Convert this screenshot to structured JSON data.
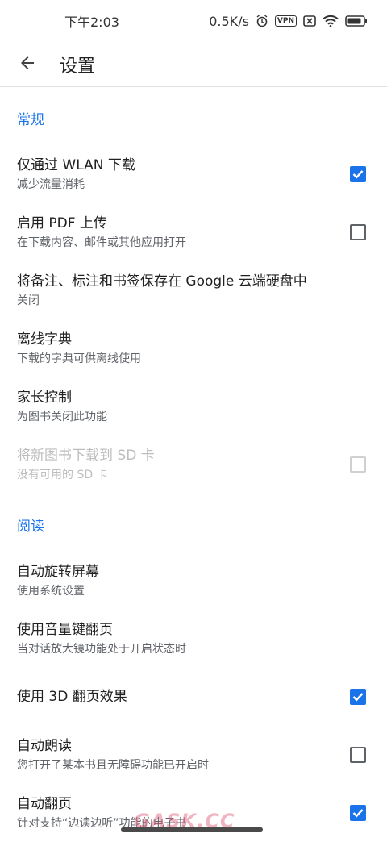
{
  "status_bar": {
    "time": "下午2:03",
    "network_speed": "0.5K/s",
    "vpn_label": "VPN",
    "icons": [
      "alarm-icon",
      "vpn-icon",
      "sim-off-icon",
      "wifi-icon",
      "battery-icon"
    ]
  },
  "app_bar": {
    "back_icon": "arrow-left-icon",
    "title": "设置"
  },
  "sections": {
    "general": {
      "header": "常规",
      "wlan": {
        "title": "仅通过 WLAN 下载",
        "summary": "减少流量消耗",
        "checked": true
      },
      "pdf": {
        "title": "启用 PDF 上传",
        "summary": "在下载内容、邮件或其他应用打开",
        "checked": false
      },
      "drive": {
        "title": "将备注、标注和书签保存在 Google 云端硬盘中",
        "summary": "关闭"
      },
      "dict": {
        "title": "离线字典",
        "summary": "下载的字典可供离线使用"
      },
      "parental": {
        "title": "家长控制",
        "summary": "为图书关闭此功能"
      },
      "sd": {
        "title": "将新图书下载到 SD 卡",
        "summary": "没有可用的 SD 卡",
        "checked": false,
        "enabled": false
      }
    },
    "reading": {
      "header": "阅读",
      "rotate": {
        "title": "自动旋转屏幕",
        "summary": "使用系统设置"
      },
      "volume": {
        "title": "使用音量键翻页",
        "summary": "当对话放大镜功能处于开启状态时"
      },
      "effect3d": {
        "title": "使用 3D 翻页效果",
        "checked": true
      },
      "autoread": {
        "title": "自动朗读",
        "summary": "您打开了某本书且无障碍功能已开启时",
        "checked": false
      },
      "autoflip": {
        "title": "自动翻页",
        "summary": "针对支持“边读边听”功能的电子书",
        "checked": true
      }
    }
  },
  "colors": {
    "accent": "#1a73e8",
    "text_primary": "#212121",
    "text_secondary": "#5f6368",
    "disabled": "#bdbdbd"
  },
  "watermark": "GASK.CC"
}
